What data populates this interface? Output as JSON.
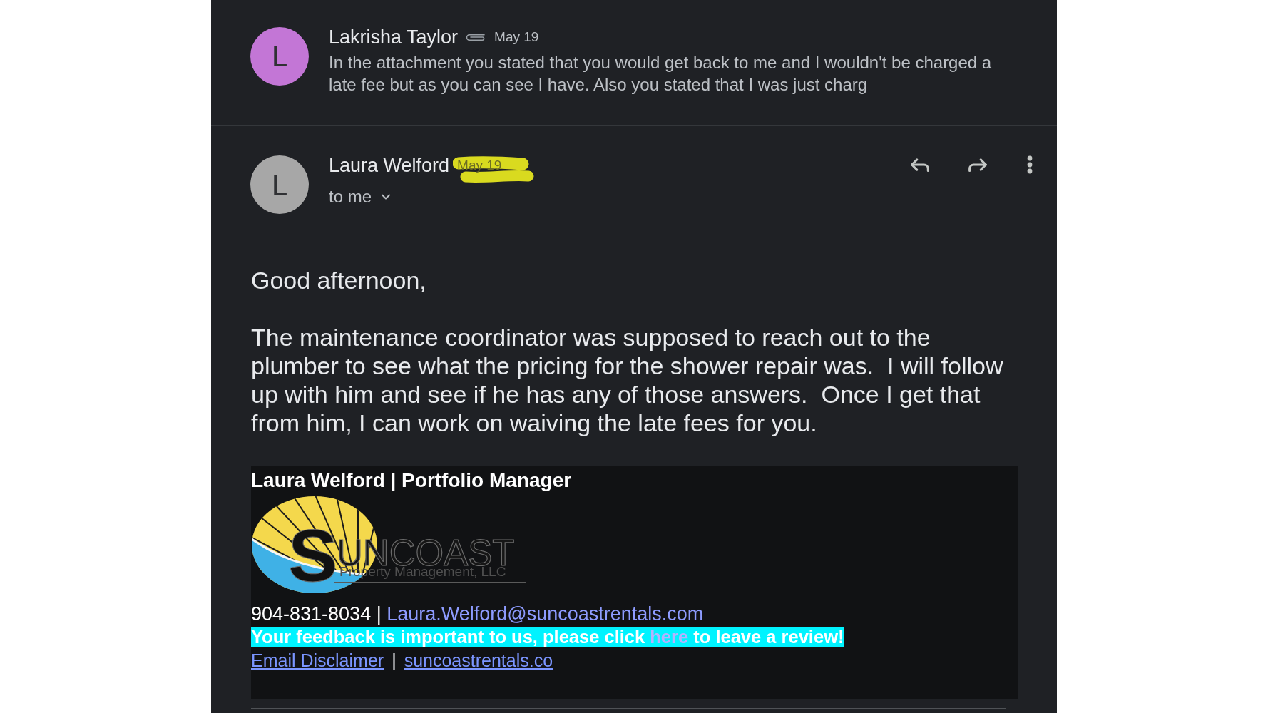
{
  "messages": [
    {
      "kind": "collapsed",
      "sender": "Lakrisha Taylor",
      "avatar_letter": "L",
      "color": "#c376d6",
      "has_attachment": true,
      "date": "May 19",
      "date_highlighted": false,
      "snippet": "In the attachment you stated that you would get back to me and I wouldn't be charged a late fee but as you can see I have. Also you stated that I was just charg"
    },
    {
      "kind": "expanded",
      "sender": "Laura Welford",
      "avatar_letter": "L",
      "color": "#a7a7a7",
      "date": "May 19",
      "date_highlighted": true,
      "recipient": "to me",
      "greeting": "Good afternoon,",
      "paragraphs": [
        "The maintenance coordinator was supposed to reach out to the plumber to see what the pricing for the shower repair was.  I will follow up with him and see if he has any of those answers.  Once I get that from him, I can work on waiving the late fees for you."
      ],
      "signature": {
        "title_line": "Laura Welford | Portfolio Manager",
        "logo": {
          "initial": "S",
          "wordmark": "UNCOAST",
          "tagline": "Property Management, LLC"
        },
        "contact": {
          "phone": "904-831-8034",
          "separator": "|",
          "email": "Laura.Welford@suncoastrentals.com"
        },
        "feedback": {
          "before": "Your feedback is important to us, please click",
          "link": "here",
          "after": "to leave a review!"
        },
        "links": [
          {
            "label": "Email Disclaimer"
          },
          {
            "label": "suncoastrentals.co"
          }
        ],
        "links_separator": "|"
      }
    }
  ]
}
